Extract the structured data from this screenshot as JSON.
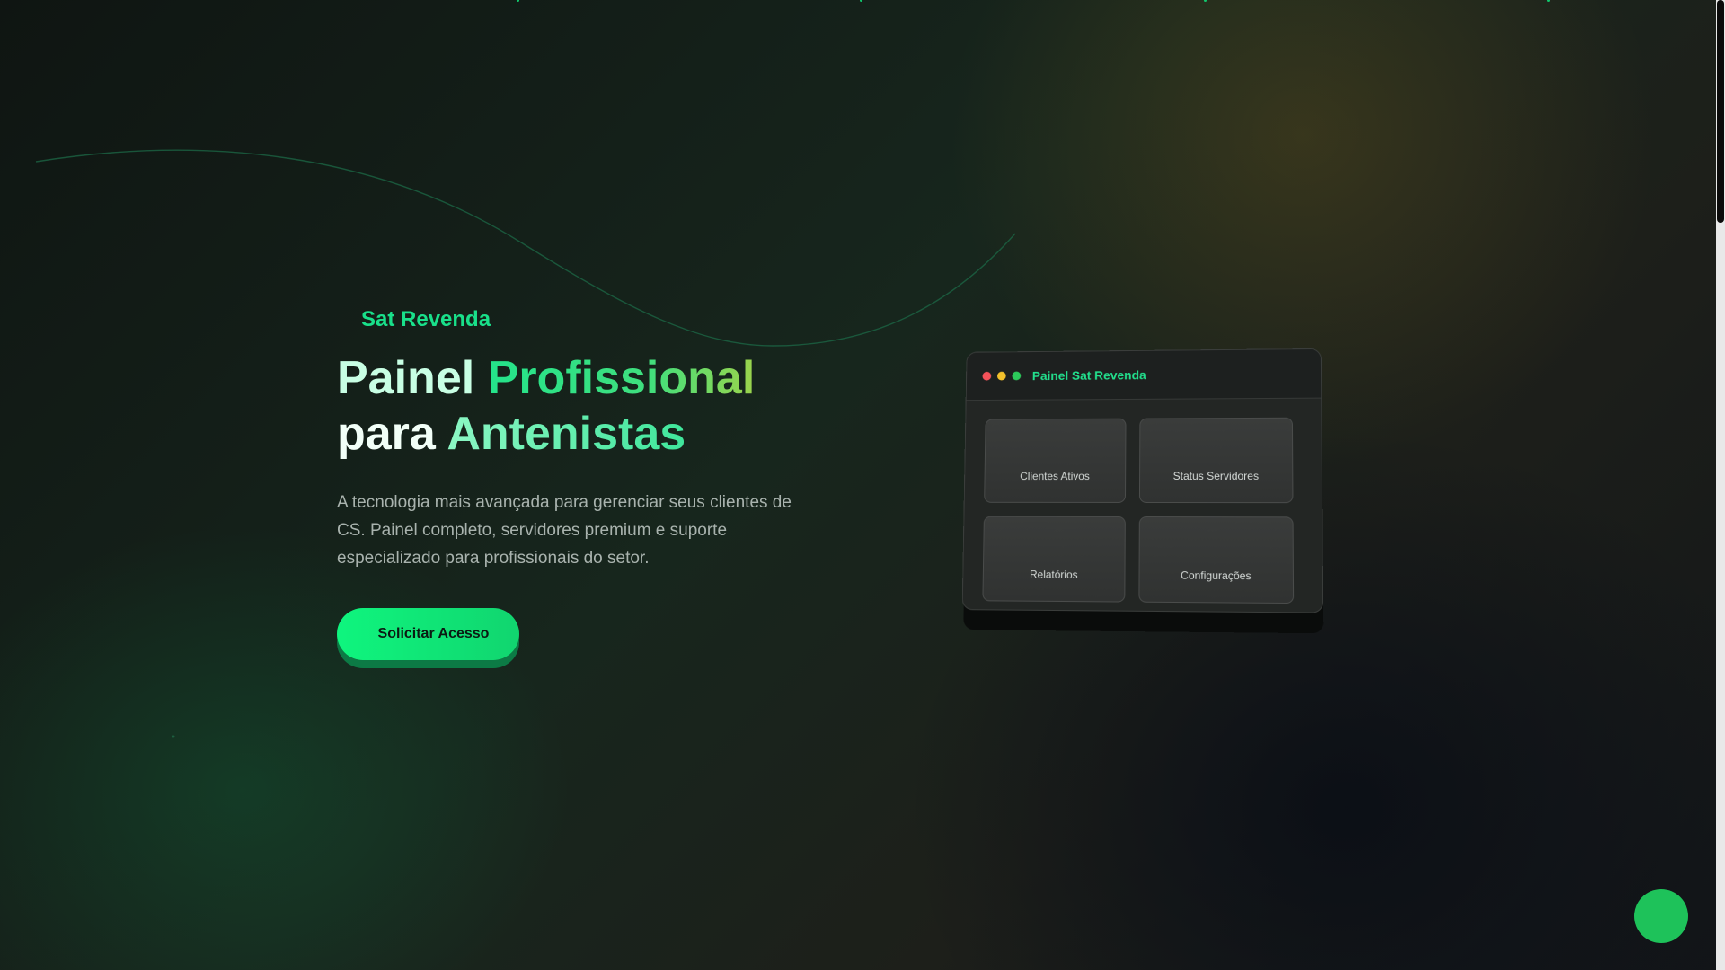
{
  "brand": {
    "name": "Sat Revenda"
  },
  "hero": {
    "headline_part1": "Painel ",
    "headline_part2": "Profissional",
    "headline_part3": "para ",
    "headline_part4": "Antenistas",
    "description": "A tecnologia mais avançada para gerenciar seus clientes de CS. Painel completo, servidores premium e suporte especializado para profissionais do setor.",
    "cta_label": "Solicitar Acesso"
  },
  "dashboard_mock": {
    "title": "Painel Sat Revenda",
    "cards": [
      {
        "label": "Clientes Ativos"
      },
      {
        "label": "Status Servidores"
      },
      {
        "label": "Relatórios"
      },
      {
        "label": "Configurações"
      }
    ]
  },
  "colors": {
    "accent": "#19e08a",
    "cta": "#0ff57e",
    "fab": "#1ec25a",
    "background": "#17261d"
  }
}
